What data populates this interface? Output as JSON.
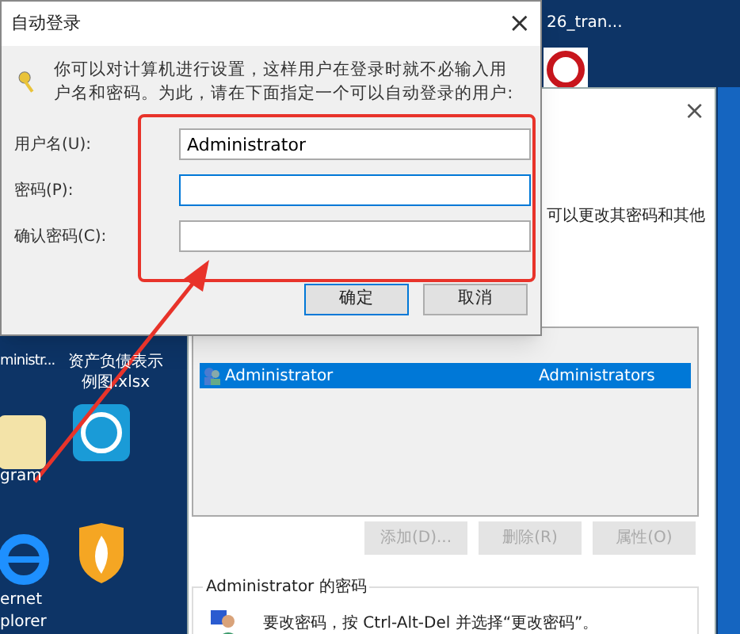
{
  "desktop": {
    "icons": [
      {
        "label": "ministr...",
        "kind": "cut"
      },
      {
        "label": "资产负债表示例图.xlsx",
        "kind": "file"
      },
      {
        "label": "gram",
        "kind": "folder"
      },
      {
        "label": "ernet",
        "kind": "browser"
      },
      {
        "label": "plorer",
        "kind": "text"
      },
      {
        "label": "26_tran...",
        "kind": "text"
      }
    ]
  },
  "back_window": {
    "close": "×",
    "note": "可以更改其密码和其他",
    "users": [
      {
        "name": "Administrator",
        "group": "Administrators",
        "selected": true
      }
    ],
    "buttons": [
      {
        "label": "添加(D)...",
        "disabled": true
      },
      {
        "label": "删除(R)",
        "disabled": true
      },
      {
        "label": "属性(O)",
        "disabled": true
      }
    ],
    "password_group": {
      "title": "Administrator 的密码",
      "message": "要改密码，按 Ctrl-Alt-Del 并选择“更改密码”。"
    }
  },
  "dialog": {
    "title": "自动登录",
    "close": "×",
    "description": "你可以对计算机进行设置，这样用户在登录时就不必输入用户名和密码。为此，请在下面指定一个可以自动登录的用户:",
    "fields": [
      {
        "label": "用户名(U):",
        "value": "Administrator",
        "focused": false
      },
      {
        "label": "密码(P):",
        "focused": true
      },
      {
        "label": "确认密码(C):",
        "focused": false
      }
    ],
    "buttons": [
      {
        "label": "确定",
        "default": true
      },
      {
        "label": "取消",
        "default": false
      }
    ]
  }
}
